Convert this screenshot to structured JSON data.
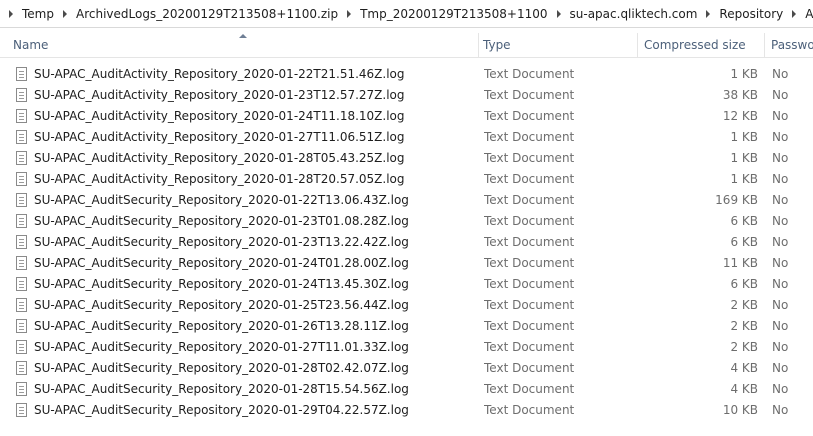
{
  "breadcrumb": [
    "Temp",
    "ArchivedLogs_20200129T213508+1100.zip",
    "Tmp_20200129T213508+1100",
    "su-apac.qliktech.com",
    "Repository",
    "Audit"
  ],
  "columns": {
    "name": "Name",
    "type": "Type",
    "compressed_size": "Compressed size",
    "password": "Password"
  },
  "sort": {
    "column": "name",
    "direction": "ascending"
  },
  "icons": {
    "breadcrumb_separator": "chevron-right-icon",
    "file": "text-document-icon",
    "sort": "sort-ascending-icon"
  },
  "files": [
    {
      "name": "SU-APAC_AuditActivity_Repository_2020-01-22T21.51.46Z.log",
      "type": "Text Document",
      "size": "1 KB",
      "password": "No"
    },
    {
      "name": "SU-APAC_AuditActivity_Repository_2020-01-23T12.57.27Z.log",
      "type": "Text Document",
      "size": "38 KB",
      "password": "No"
    },
    {
      "name": "SU-APAC_AuditActivity_Repository_2020-01-24T11.18.10Z.log",
      "type": "Text Document",
      "size": "12 KB",
      "password": "No"
    },
    {
      "name": "SU-APAC_AuditActivity_Repository_2020-01-27T11.06.51Z.log",
      "type": "Text Document",
      "size": "1 KB",
      "password": "No"
    },
    {
      "name": "SU-APAC_AuditActivity_Repository_2020-01-28T05.43.25Z.log",
      "type": "Text Document",
      "size": "1 KB",
      "password": "No"
    },
    {
      "name": "SU-APAC_AuditActivity_Repository_2020-01-28T20.57.05Z.log",
      "type": "Text Document",
      "size": "1 KB",
      "password": "No"
    },
    {
      "name": "SU-APAC_AuditSecurity_Repository_2020-01-22T13.06.43Z.log",
      "type": "Text Document",
      "size": "169 KB",
      "password": "No"
    },
    {
      "name": "SU-APAC_AuditSecurity_Repository_2020-01-23T01.08.28Z.log",
      "type": "Text Document",
      "size": "6 KB",
      "password": "No"
    },
    {
      "name": "SU-APAC_AuditSecurity_Repository_2020-01-23T13.22.42Z.log",
      "type": "Text Document",
      "size": "6 KB",
      "password": "No"
    },
    {
      "name": "SU-APAC_AuditSecurity_Repository_2020-01-24T01.28.00Z.log",
      "type": "Text Document",
      "size": "11 KB",
      "password": "No"
    },
    {
      "name": "SU-APAC_AuditSecurity_Repository_2020-01-24T13.45.30Z.log",
      "type": "Text Document",
      "size": "6 KB",
      "password": "No"
    },
    {
      "name": "SU-APAC_AuditSecurity_Repository_2020-01-25T23.56.44Z.log",
      "type": "Text Document",
      "size": "2 KB",
      "password": "No"
    },
    {
      "name": "SU-APAC_AuditSecurity_Repository_2020-01-26T13.28.11Z.log",
      "type": "Text Document",
      "size": "2 KB",
      "password": "No"
    },
    {
      "name": "SU-APAC_AuditSecurity_Repository_2020-01-27T11.01.33Z.log",
      "type": "Text Document",
      "size": "2 KB",
      "password": "No"
    },
    {
      "name": "SU-APAC_AuditSecurity_Repository_2020-01-28T02.42.07Z.log",
      "type": "Text Document",
      "size": "4 KB",
      "password": "No"
    },
    {
      "name": "SU-APAC_AuditSecurity_Repository_2020-01-28T15.54.56Z.log",
      "type": "Text Document",
      "size": "4 KB",
      "password": "No"
    },
    {
      "name": "SU-APAC_AuditSecurity_Repository_2020-01-29T04.22.57Z.log",
      "type": "Text Document",
      "size": "10 KB",
      "password": "No"
    }
  ]
}
